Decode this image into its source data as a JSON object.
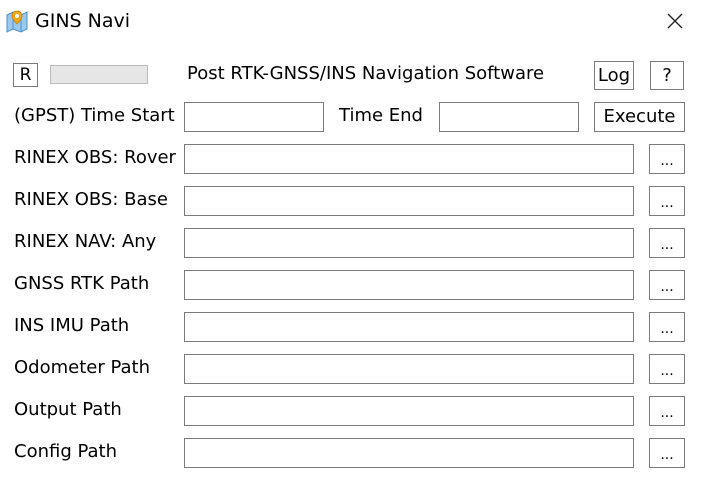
{
  "window": {
    "title": "GINS Navi",
    "icon": "map-pin-icon",
    "close_icon": "close-icon"
  },
  "header": {
    "reset_label": "R",
    "progress": 0,
    "subtitle": "Post RTK-GNSS/INS Navigation Software",
    "log_label": "Log",
    "help_label": "?"
  },
  "time": {
    "start_label": "(GPST) Time Start",
    "start_value": "",
    "end_label": "Time End",
    "end_value": "",
    "execute_label": "Execute"
  },
  "rows": [
    {
      "label": "RINEX OBS: Rover",
      "value": "",
      "browse_label": "..."
    },
    {
      "label": "RINEX OBS: Base",
      "value": "",
      "browse_label": "..."
    },
    {
      "label": "RINEX NAV: Any",
      "value": "",
      "browse_label": "..."
    },
    {
      "label": "GNSS RTK Path",
      "value": "",
      "browse_label": "..."
    },
    {
      "label": "INS IMU Path",
      "value": "",
      "browse_label": "..."
    },
    {
      "label": "Odometer Path",
      "value": "",
      "browse_label": "..."
    },
    {
      "label": "Output Path",
      "value": "",
      "browse_label": "..."
    },
    {
      "label": "Config Path",
      "value": "",
      "browse_label": "..."
    }
  ],
  "colors": {
    "progress_fill": "#06b025",
    "border": "#7a7a7a"
  }
}
